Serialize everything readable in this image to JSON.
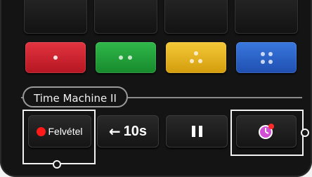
{
  "remote": {
    "top_buttons": [
      "",
      "",
      "",
      ""
    ],
    "color_buttons": [
      {
        "name": "red",
        "color": "#cc1f2a",
        "dots": 1
      },
      {
        "name": "green",
        "color": "#22a03a",
        "dots": 2
      },
      {
        "name": "yellow",
        "color": "#e5b51a",
        "dots": 3
      },
      {
        "name": "blue",
        "color": "#2660c8",
        "dots": 4
      }
    ],
    "group_label": "Time Machine II",
    "controls": {
      "record_label": "Felvétel",
      "rewind_label": "10s",
      "pause_icon": "pause-icon",
      "timer_icon": "timer-record-icon"
    }
  }
}
